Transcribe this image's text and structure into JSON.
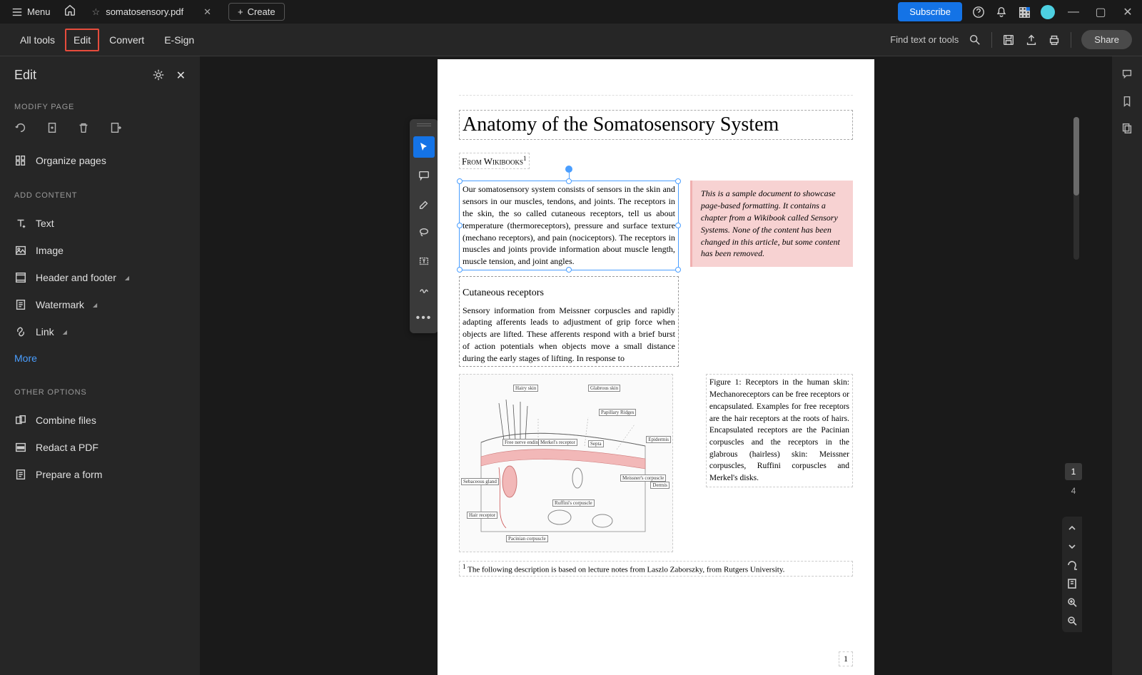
{
  "titlebar": {
    "menu": "Menu",
    "tab_title": "somatosensory.pdf",
    "create": "Create",
    "subscribe": "Subscribe"
  },
  "toolbar": {
    "all_tools": "All tools",
    "edit": "Edit",
    "convert": "Convert",
    "esign": "E-Sign",
    "find": "Find text or tools",
    "share": "Share"
  },
  "edit_panel": {
    "title": "Edit",
    "modify_label": "MODIFY PAGE",
    "organize": "Organize pages",
    "add_label": "ADD CONTENT",
    "text": "Text",
    "image": "Image",
    "header": "Header and footer",
    "watermark": "Watermark",
    "link": "Link",
    "more": "More",
    "other_label": "OTHER OPTIONS",
    "combine": "Combine files",
    "redact": "Redact a PDF",
    "prepare": "Prepare a form"
  },
  "doc": {
    "title": "Anatomy of the Somatosensory System",
    "subtitle_pre": "From Wikibooks",
    "para1": "Our somatosensory system consists of sensors in the skin and sensors in our muscles, tendons, and joints. The receptors in the skin, the so called cutaneous receptors, tell us about temperature (thermoreceptors), pressure and surface texture (mechano receptors), and pain (nociceptors). The receptors in muscles and joints provide information about muscle length, muscle tension, and joint angles.",
    "note": "This is a sample document to showcase page-based formatting. It contains a chapter from a Wikibook called Sensory Systems. None of the content has been changed in this article, but some content has been removed.",
    "h2": "Cutaneous receptors",
    "para2": "Sensory information from Meissner corpuscles and rapidly adapting afferents leads to adjustment of grip force when objects are lifted. These afferents respond with a brief burst of action potentials when objects move a small distance during the early stages of lifting. In response to",
    "fig_caption": "Figure 1:  Receptors in the human skin: Mechanoreceptors can be free receptors or encapsulated. Examples for free receptors are the hair receptors at the roots of hairs. Encapsulated receptors are the Pacinian corpuscles and the receptors in the glabrous (hairless) skin: Meissner corpuscles, Ruffini corpuscles and Merkel's disks.",
    "fig_labels": {
      "hairy": "Hairy skin",
      "glabrous": "Glabrous skin",
      "papillary": "Papillary Ridges",
      "epidermis": "Epidermis",
      "dermis": "Dermis",
      "free_nerve": "Free nerve ending",
      "merkels": "Merkel's receptor",
      "meissners": "Meissner's corpuscle",
      "ruffinis": "Ruffini's corpuscle",
      "hair_receptor": "Hair receptor",
      "pacinian": "Pacinian corpuscle",
      "sebaceous": "Sebaceous gland",
      "septa": "Septa"
    },
    "footnote": " The following description is based on lecture notes from Laszlo Zaborszky, from Rutgers University.",
    "footnote_num": "1",
    "page_num": "1"
  },
  "nav": {
    "current_page": "1",
    "total_pages": "4"
  }
}
